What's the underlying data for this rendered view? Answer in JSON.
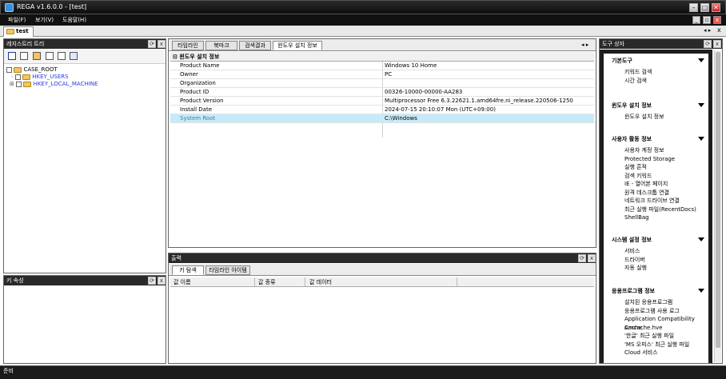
{
  "window": {
    "title": "REGA v1.6.0.0 - [test]"
  },
  "menu": [
    "파일(F)",
    "보기(V)",
    "도움말(H)"
  ],
  "doc_tab": "test",
  "registry_tree": {
    "title": "레지스트리 트리",
    "nodes": [
      "CASE_ROOT",
      "HKEY_USERS",
      "HKEY_LOCAL_MACHINE"
    ]
  },
  "key_props": {
    "title": "키 속성"
  },
  "main_tabs": [
    "타임라인",
    "북마크",
    "검색결과",
    "윈도우 설치 정보"
  ],
  "install_info": {
    "group": "윈도우 설치 정보",
    "rows": [
      {
        "key": "Product Name",
        "value": "Windows 10 Home"
      },
      {
        "key": "Owner",
        "value": "PC"
      },
      {
        "key": "Organization",
        "value": ""
      },
      {
        "key": "Product ID",
        "value": "00326-10000-00000-AA283"
      },
      {
        "key": "Product Version",
        "value": "Multiprocessor Free 6.3.22621.1.amd64fre.ni_release.220506-1250"
      },
      {
        "key": "Install Date",
        "value": "2024-07-15  20:10:07  Mon (UTC+09:00)"
      },
      {
        "key": "System Root",
        "value": "C:\\Windows"
      }
    ]
  },
  "output": {
    "title": "출력",
    "tabs": [
      "키 탐색",
      "타임라인 아이템"
    ],
    "columns": [
      "값 이름",
      "값 종류",
      "값 데이터"
    ]
  },
  "toolbox": {
    "title": "도구 상자",
    "sections": [
      {
        "title": "기본도구",
        "items": [
          "키워드 검색",
          "시간 검색"
        ]
      },
      {
        "title": "윈도우 설치 정보",
        "items": [
          "윈도우 설치 정보"
        ]
      },
      {
        "title": "사용자 활동 정보",
        "items": [
          "사용자 계정 정보",
          "Protected Storage",
          "실행 흔적",
          "검색 키워드",
          "IE - 열어본 페이지",
          "원격 데스크톱 연결",
          "네트워크 드라이브 연결",
          "최근 실행 파일(RecentDocs)",
          "ShellBag"
        ]
      },
      {
        "title": "시스템 설정 정보",
        "items": [
          "서비스",
          "드라이버",
          "자동 실행"
        ]
      },
      {
        "title": "응용프로그램 정보",
        "items": [
          "설치된 응용프로그램",
          "응용프로그램 사용 로그",
          "Application Compatibility Cache",
          "Amcache.hve",
          "'한글' 최근 실행 파일",
          "'MS 오피스' 최근 실행 파일",
          "Cloud 서비스"
        ]
      }
    ]
  },
  "status": "준비"
}
